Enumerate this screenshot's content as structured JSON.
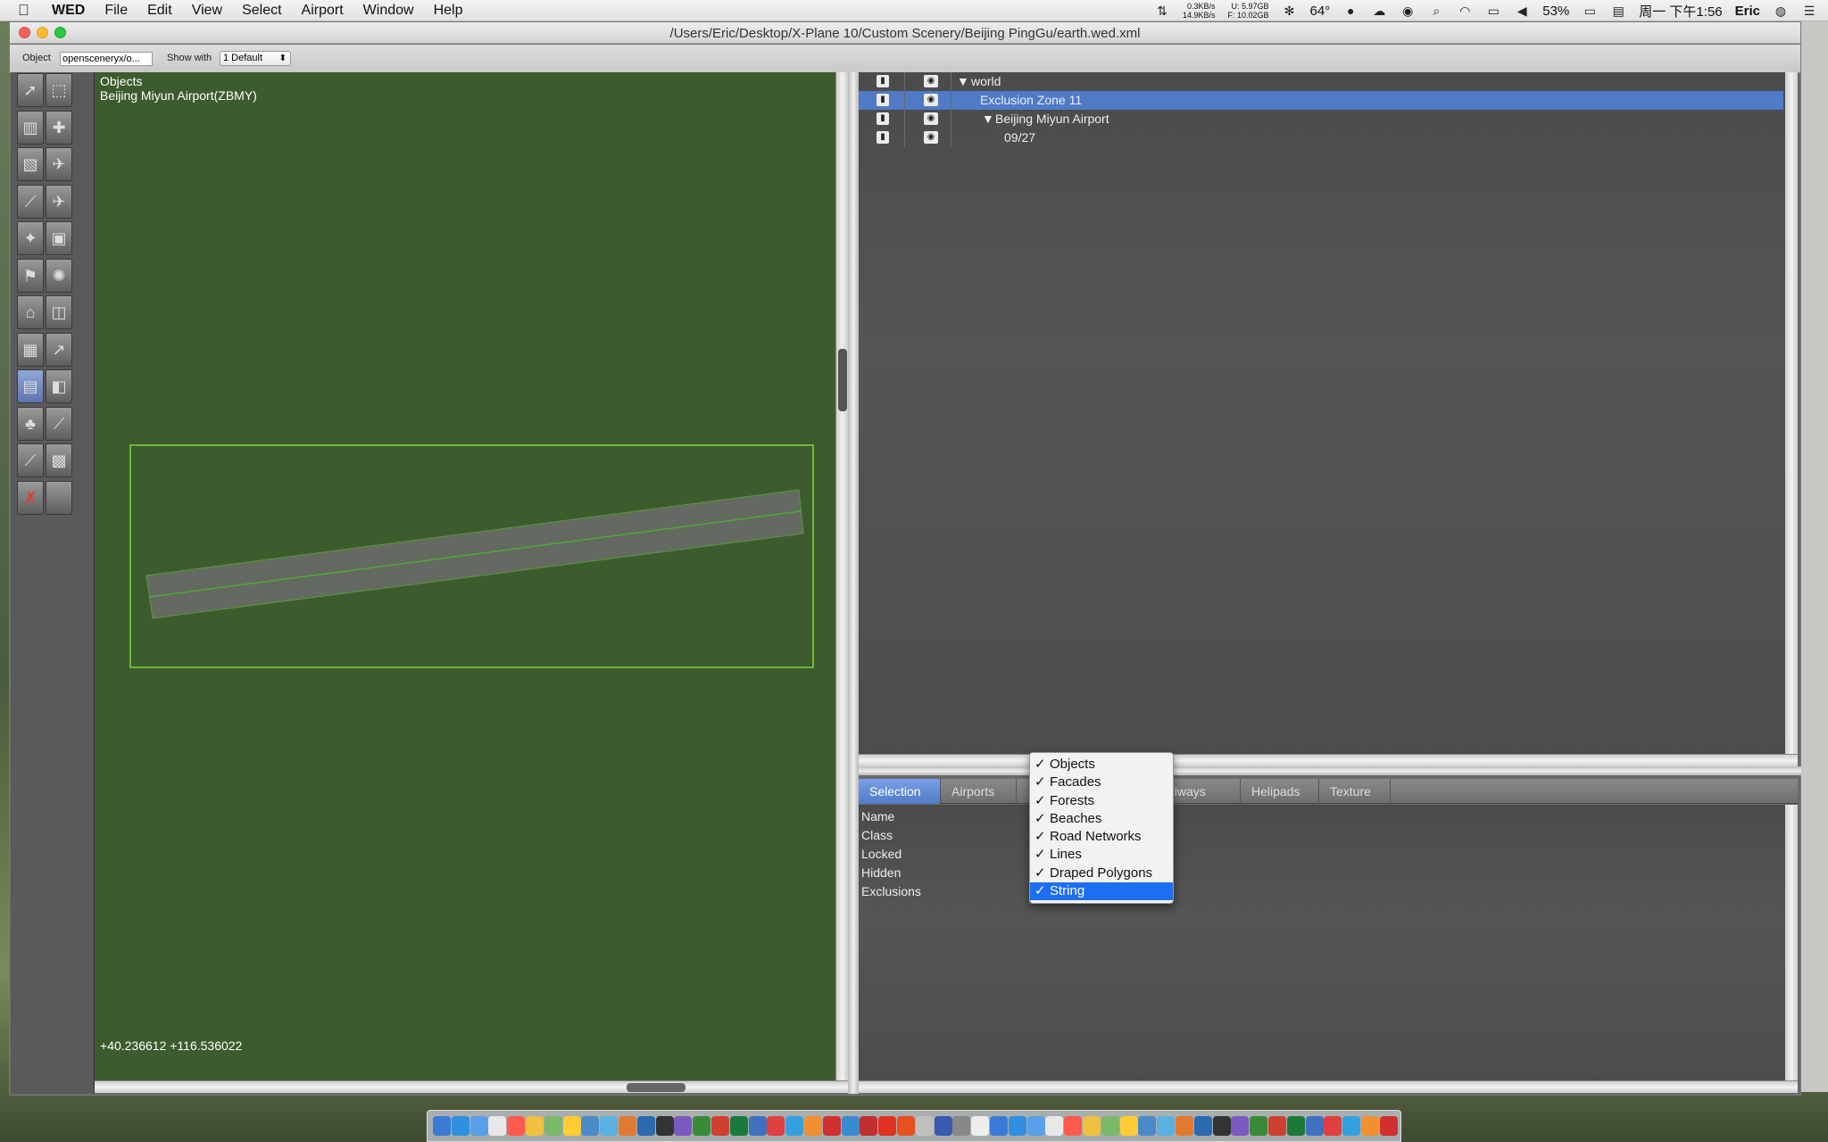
{
  "menubar": {
    "app_name": "WED",
    "items": [
      "File",
      "Edit",
      "View",
      "Select",
      "Airport",
      "Window",
      "Help"
    ],
    "net_up": "0.3KB/s",
    "net_down": "14.9KB/s",
    "disk_used": "U:  5.97GB",
    "disk_free": "F:  10.02GB",
    "temperature": "64°",
    "battery": "53%",
    "datetime": "周一 下午1:56",
    "user": "Eric"
  },
  "window": {
    "title": "/Users/Eric/Desktop/X-Plane 10/Custom Scenery/Beijing PingGu/earth.wed.xml"
  },
  "optionbar": {
    "object_label": "Object",
    "object_value": "opensceneryx/o...",
    "show_with_label": "Show with",
    "show_with_value": "1 Default"
  },
  "map": {
    "title": "Objects",
    "airport": "Beijing Miyun Airport(ZBMY)",
    "coordinates": "+40.236612 +116.536022"
  },
  "hierarchy": {
    "rows": [
      {
        "label": "world",
        "expanded": true,
        "selected": false
      },
      {
        "label": "Exclusion Zone 11",
        "selected": true
      },
      {
        "label": "Beijing Miyun Airport",
        "expanded": true,
        "selected": false
      },
      {
        "label": "09/27",
        "selected": false
      }
    ]
  },
  "inspector": {
    "tabs": [
      "Selection",
      "Airports",
      "Taxiways",
      "Helipads",
      "Texture"
    ],
    "active_tab": "Selection",
    "properties": [
      "Name",
      "Class",
      "Locked",
      "Hidden",
      "Exclusions"
    ]
  },
  "exclusions_menu": {
    "items": [
      {
        "label": "Objects",
        "checked": true
      },
      {
        "label": "Facades",
        "checked": true
      },
      {
        "label": "Forests",
        "checked": true
      },
      {
        "label": "Beaches",
        "checked": true
      },
      {
        "label": "Road Networks",
        "checked": true
      },
      {
        "label": "Lines",
        "checked": true
      },
      {
        "label": "Draped Polygons",
        "checked": true
      },
      {
        "label": "String",
        "checked": true
      }
    ],
    "highlighted": "String",
    "check_glyph": "✓"
  },
  "colors": {
    "map_bg": "#3d5c2e",
    "selection_blue": "#4f7bc6",
    "menu_highlight": "#1d6ff2",
    "boundary_green": "#7cd63a"
  }
}
